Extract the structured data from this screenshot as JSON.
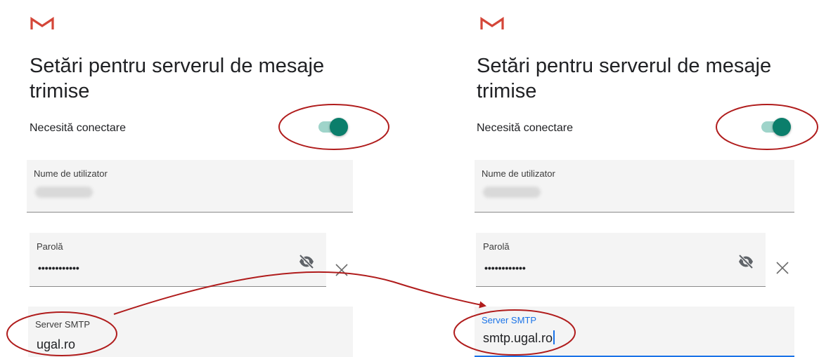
{
  "colors": {
    "accent": "#0b7e6b",
    "toggle_track": "#9fd4ca",
    "focus_blue": "#1a73e8",
    "annotation": "#b01c1c",
    "gmail_red": "#d44638"
  },
  "panels": [
    {
      "app_icon": "gmail-m-icon",
      "title": "Setări pentru serverul de mesaje trimise",
      "toggle": {
        "label": "Necesită conectare",
        "on": true
      },
      "username": {
        "label": "Nume de utilizator",
        "value_state": "blurred"
      },
      "password": {
        "label": "Parolă",
        "value": "••••••••••••",
        "icon": "visibility-off-icon"
      },
      "clear_icon": "close-icon",
      "smtp": {
        "label": "Server SMTP",
        "value": "ugal.ro",
        "focused": false
      }
    },
    {
      "app_icon": "gmail-m-icon",
      "title": "Setări pentru serverul de mesaje trimise",
      "toggle": {
        "label": "Necesită conectare",
        "on": true
      },
      "username": {
        "label": "Nume de utilizator",
        "value_state": "blurred"
      },
      "password": {
        "label": "Parolă",
        "value": "••••••••••••",
        "icon": "visibility-off-icon"
      },
      "clear_icon": "close-icon",
      "smtp": {
        "label": "Server SMTP",
        "value": "smtp.ugal.ro",
        "focused": true
      }
    }
  ],
  "annotations": {
    "shapes": [
      "ellipse-around-left-toggle",
      "ellipse-around-right-toggle",
      "ellipse-around-left-smtp",
      "ellipse-around-right-smtp"
    ],
    "arrow": "left-smtp-to-right-smtp"
  }
}
